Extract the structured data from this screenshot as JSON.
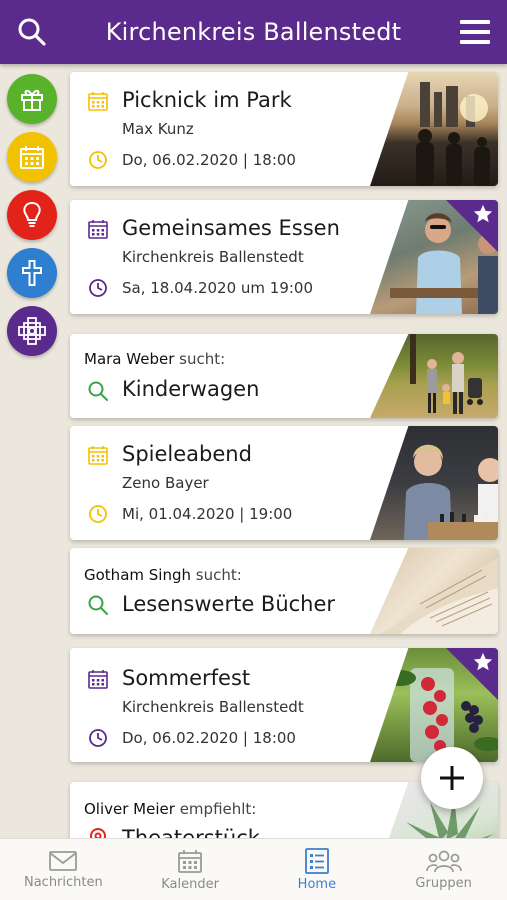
{
  "header": {
    "title": "Kirchenkreis Ballenstedt"
  },
  "colors": {
    "brand": "#5a2a8c",
    "accent_blue": "#3b7fd1",
    "event_yellow": "#f2c200",
    "search_green": "#3aa34a"
  },
  "categories": [
    {
      "name": "gift-icon",
      "color": "#58b32b"
    },
    {
      "name": "calendar-icon",
      "color": "#f2c200"
    },
    {
      "name": "lightbulb-icon",
      "color": "#e2231a"
    },
    {
      "name": "cross-icon",
      "color": "#2e7fd0"
    },
    {
      "name": "celtic-cross-icon",
      "color": "#5a2a8c"
    }
  ],
  "feed": [
    {
      "type": "event",
      "title": "Picknick im Park",
      "organizer": "Max Kunz",
      "date": "Do, 06.02.2020 | 18:00"
    },
    {
      "type": "event",
      "title": "Gemeinsames Essen",
      "organizer": "Kirchenkreis Ballenstedt",
      "date": "Sa, 18.04.2020 um 19:00",
      "featured": true
    },
    {
      "type": "search",
      "user": "Mara Weber",
      "verb": "sucht:",
      "title": "Kinderwagen"
    },
    {
      "type": "event",
      "title": "Spieleabend",
      "organizer": "Zeno Bayer",
      "date": "Mi, 01.04.2020 | 19:00"
    },
    {
      "type": "search",
      "user": "Gotham Singh",
      "verb": "sucht:",
      "title": "Lesenswerte Bücher"
    },
    {
      "type": "event",
      "title": "Sommerfest",
      "organizer": "Kirchenkreis Ballenstedt",
      "date": "Do, 06.02.2020 | 18:00",
      "featured": true
    },
    {
      "type": "recommend",
      "user": "Oliver Meier",
      "verb": "empfiehlt:",
      "title": "Theaterstück"
    }
  ],
  "bottom_nav": [
    {
      "label": "Nachrichten",
      "icon": "mail-icon"
    },
    {
      "label": "Kalender",
      "icon": "calendar-icon"
    },
    {
      "label": "Home",
      "icon": "list-icon",
      "active": true
    },
    {
      "label": "Gruppen",
      "icon": "group-icon"
    }
  ]
}
